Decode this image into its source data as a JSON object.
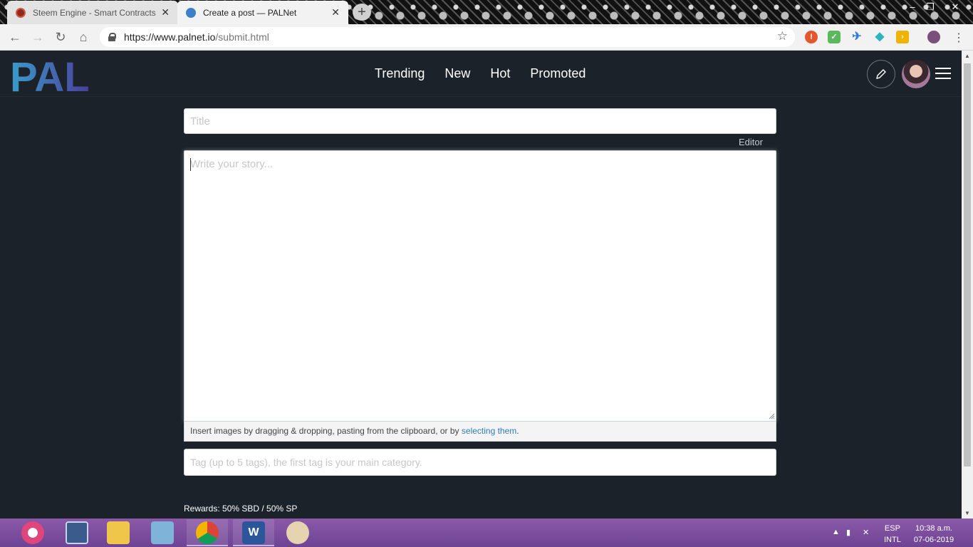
{
  "browser": {
    "tabs": [
      {
        "title": "Steem Engine - Smart Contracts",
        "active": false
      },
      {
        "title": "Create a post — PALNet",
        "active": true
      }
    ],
    "url": {
      "protocol": "https://",
      "host": "www.palnet.io",
      "path": "/submit.html"
    }
  },
  "site": {
    "logo_text": "PAL",
    "nav": [
      "Trending",
      "New",
      "Hot",
      "Promoted"
    ]
  },
  "form": {
    "title_placeholder": "Title",
    "editor_label": "Editor",
    "body_placeholder": "Write your story...",
    "dropzone_prefix": "Insert images by dragging & dropping, pasting from the clipboard, or by ",
    "dropzone_link": "selecting them",
    "dropzone_suffix": ".",
    "tags_placeholder": "Tag (up to 5 tags), the first tag is your main category.",
    "rewards": "Rewards: 50% SBD / 50% SP"
  },
  "taskbar": {
    "lang_top": "ESP",
    "lang_bottom": "INTL",
    "time": "10:38 a.m.",
    "date": "07-06-2019"
  },
  "colors": {
    "page_bg": "#1b222a",
    "logo_gradient_start": "#3a9cc9",
    "logo_gradient_end": "#4a3e9c",
    "link": "#2f7bb8"
  }
}
